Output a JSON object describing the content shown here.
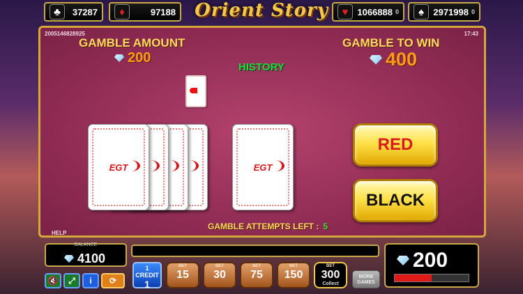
{
  "logo": "Orient Story",
  "jackpots": [
    {
      "suit": "♣",
      "value": "37287",
      "level": ""
    },
    {
      "suit": "♦",
      "value": "97188",
      "level": ""
    },
    {
      "suit": "♥",
      "value": "1066888",
      "level": "0"
    },
    {
      "suit": "♠",
      "value": "2971998",
      "level": "0"
    }
  ],
  "panel": {
    "game_id": "2005146828925",
    "clock": "17:43",
    "gamble_amount_label": "GAMBLE AMOUNT",
    "gamble_amount": "200",
    "gamble_to_win_label": "GAMBLE TO WIN",
    "gamble_to_win": "400",
    "history_label": "HISTORY",
    "card_logo": "EGT",
    "red_label": "RED",
    "black_label": "BLACK",
    "attempts_label": "GAMBLE ATTEMPTS LEFT :",
    "attempts_left": "5",
    "help_label": "HELP"
  },
  "bottom": {
    "balance_label": "BALANCE",
    "balance": "4100",
    "win": "200",
    "credit_label": "1 CREDIT",
    "credit_value": "1",
    "bet_tag": "BET",
    "bets": [
      "15",
      "30",
      "75",
      "150",
      "300"
    ],
    "collect_label": "Collect",
    "more_games": "MORE GAMES"
  },
  "colors": {
    "gold": "#d4a83a",
    "panel": "#8d2a52",
    "green": "#1bdc3a",
    "orange": "#ff9a1a"
  }
}
